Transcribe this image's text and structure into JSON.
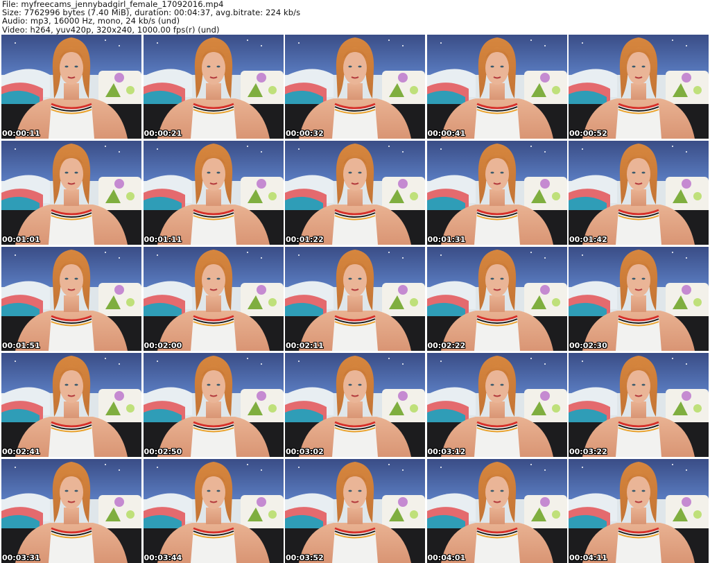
{
  "header": {
    "file": "File: myfreecams_jennybadgirl_female_17092016.mp4",
    "size": "Size: 7762996 bytes (7.40 MiB), duration: 00:04:37, avg.bitrate: 224 kb/s",
    "audio": "Audio: mp3, 16000 Hz, mono, 24 kb/s (und)",
    "video": "Video: h264, yuv420p, 320x240, 1000.00 fps(r) (und)"
  },
  "thumbnails": [
    {
      "time": "00:00:11"
    },
    {
      "time": "00:00:21"
    },
    {
      "time": "00:00:32"
    },
    {
      "time": "00:00:41"
    },
    {
      "time": "00:00:52"
    },
    {
      "time": "00:01:01"
    },
    {
      "time": "00:01:11"
    },
    {
      "time": "00:01:22"
    },
    {
      "time": "00:01:31"
    },
    {
      "time": "00:01:42"
    },
    {
      "time": "00:01:51"
    },
    {
      "time": "00:02:00"
    },
    {
      "time": "00:02:11"
    },
    {
      "time": "00:02:22"
    },
    {
      "time": "00:02:30"
    },
    {
      "time": "00:02:41"
    },
    {
      "time": "00:02:50"
    },
    {
      "time": "00:03:02"
    },
    {
      "time": "00:03:12"
    },
    {
      "time": "00:03:22"
    },
    {
      "time": "00:03:31"
    },
    {
      "time": "00:03:44"
    },
    {
      "time": "00:03:52"
    },
    {
      "time": "00:04:01"
    },
    {
      "time": "00:04:11"
    }
  ]
}
